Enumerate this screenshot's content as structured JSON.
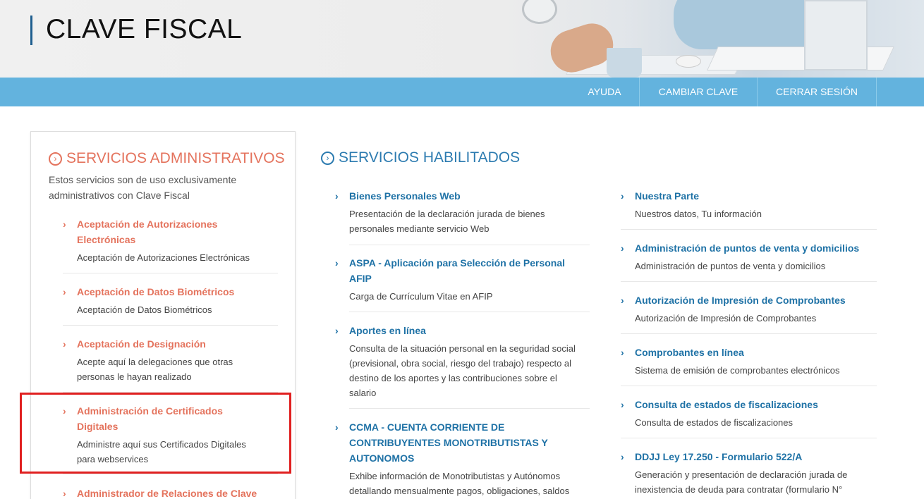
{
  "header": {
    "title": "CLAVE FISCAL"
  },
  "nav": {
    "items": [
      "AYUDA",
      "CAMBIAR CLAVE",
      "CERRAR SESIÓN"
    ]
  },
  "admin": {
    "heading": "SERVICIOS ADMINISTRATIVOS",
    "description": "Estos servicios son de uso exclusivamente administrativos con Clave Fiscal",
    "services": [
      {
        "title_lines": [
          "Aceptación de Autorizaciones",
          "Electrónicas"
        ],
        "desc_lines": [
          "Aceptación de Autorizaciones Electrónicas"
        ]
      },
      {
        "title_lines": [
          "Aceptación de Datos Biométricos"
        ],
        "desc_lines": [
          "Aceptación de Datos Biométricos"
        ]
      },
      {
        "title_lines": [
          "Aceptación de Designación"
        ],
        "desc_lines": [
          "Acepte aquí la delegaciones que otras",
          "personas le hayan realizado"
        ]
      },
      {
        "title_lines": [
          "Administración de Certificados",
          "Digitales"
        ],
        "desc_lines": [
          "Administre aquí sus Certificados Digitales",
          "para webservices"
        ]
      },
      {
        "title_lines": [
          "Administrador de Relaciones de Clave"
        ],
        "desc_lines": []
      }
    ]
  },
  "habilitados": {
    "heading": "SERVICIOS HABILITADOS",
    "col1": [
      {
        "title_lines": [
          "Bienes Personales Web"
        ],
        "desc_lines": [
          "Presentación de la declaración jurada de bienes",
          "personales mediante servicio Web"
        ]
      },
      {
        "title_lines": [
          "ASPA - Aplicación para Selección de Personal",
          "AFIP"
        ],
        "desc_lines": [
          "Carga de Currículum Vitae en AFIP"
        ]
      },
      {
        "title_lines": [
          "Aportes en línea"
        ],
        "desc_lines": [
          "Consulta de la situación personal en la seguridad social",
          "(previsional, obra social, riesgo del trabajo) respecto al",
          "destino de los aportes y las contribuciones sobre el",
          "salario"
        ]
      },
      {
        "title_lines": [
          "CCMA - CUENTA CORRIENTE DE",
          "CONTRIBUYENTES MONOTRIBUTISTAS Y",
          "AUTONOMOS"
        ],
        "desc_lines": [
          "Exhibe información de Monotributistas y Autónomos",
          "detallando mensualmente pagos, obligaciones, saldos"
        ]
      }
    ],
    "col2": [
      {
        "title_lines": [
          "Nuestra Parte"
        ],
        "desc_lines": [
          "Nuestros datos, Tu información"
        ]
      },
      {
        "title_lines": [
          "Administración de puntos de venta y domicilios"
        ],
        "desc_lines": [
          "Administración de puntos de venta y domicilios"
        ]
      },
      {
        "title_lines": [
          "Autorización de Impresión de Comprobantes"
        ],
        "desc_lines": [
          "Autorización de Impresión de Comprobantes"
        ]
      },
      {
        "title_lines": [
          "Comprobantes en línea"
        ],
        "desc_lines": [
          "Sistema de emisión de comprobantes electrónicos"
        ]
      },
      {
        "title_lines": [
          "Consulta de estados de fiscalizaciones"
        ],
        "desc_lines": [
          "Consulta de estados de fiscalizaciones"
        ]
      },
      {
        "title_lines": [
          "DDJJ Ley 17.250 - Formulario 522/A"
        ],
        "desc_lines": [
          "Generación y presentación de declaración jurada de",
          "inexistencia de deuda para contratar (formulario N°"
        ]
      }
    ]
  },
  "colors": {
    "nav_bg": "#63b3de",
    "admin_accent": "#e4735d",
    "habilitados_accent": "#1f72a6",
    "highlight": "#e02020"
  },
  "icons": {
    "section": "circle-chevron-right-icon",
    "item": "chevron-right-icon"
  }
}
